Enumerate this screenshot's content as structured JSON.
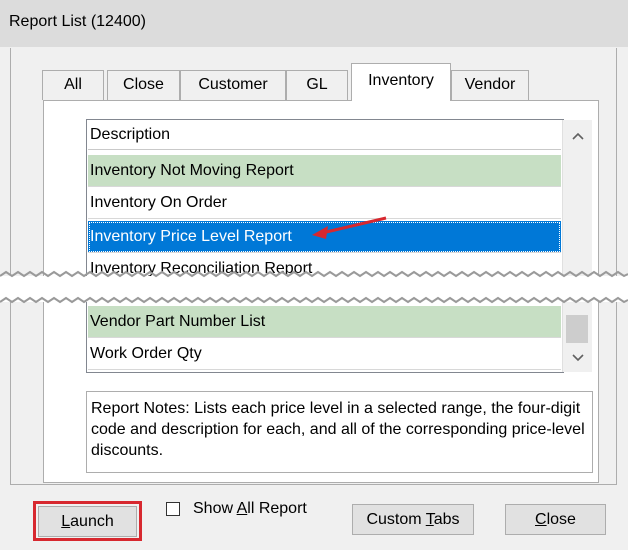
{
  "window": {
    "title": "Report List (12400)"
  },
  "tabs": [
    {
      "label": "All",
      "active": false
    },
    {
      "label": "Close",
      "active": false
    },
    {
      "label": "Customer",
      "active": false
    },
    {
      "label": "GL",
      "active": false
    },
    {
      "label": "Inventory",
      "active": true
    },
    {
      "label": "Vendor",
      "active": false
    }
  ],
  "report_list": {
    "header": "Description",
    "rows_top": [
      {
        "label": "Inventory Not Moving Report",
        "style": "green"
      },
      {
        "label": "Inventory On Order",
        "style": "white"
      },
      {
        "label": "Inventory Price Level Report",
        "style": "selected"
      },
      {
        "label": "Inventory Reconciliation Report",
        "style": "white"
      }
    ],
    "rows_bottom": [
      {
        "label": "Vendor Part Number List",
        "style": "green"
      },
      {
        "label": "Work Order Qty",
        "style": "white"
      }
    ]
  },
  "notes": {
    "text": "Report Notes:  Lists each price level in a selected range, the four-digit code and description for each, and all of the corresponding price-level discounts."
  },
  "buttons": {
    "launch": {
      "pre": "",
      "ul": "L",
      "post": "aunch"
    },
    "show_all": {
      "pre": "Show ",
      "ul": "A",
      "post": "ll Report",
      "checked": false
    },
    "custom_tabs": {
      "pre": "Custom ",
      "ul": "T",
      "post": "abs"
    },
    "close": {
      "pre": "",
      "ul": "C",
      "post": "lose"
    }
  },
  "colors": {
    "selected": "#0078d7",
    "green_row": "#c7dfc4",
    "callout": "#d7282f"
  },
  "icons": {
    "scroll_up": "chevron-up-icon",
    "scroll_down": "chevron-down-icon",
    "pointer": "red-arrow-icon"
  }
}
